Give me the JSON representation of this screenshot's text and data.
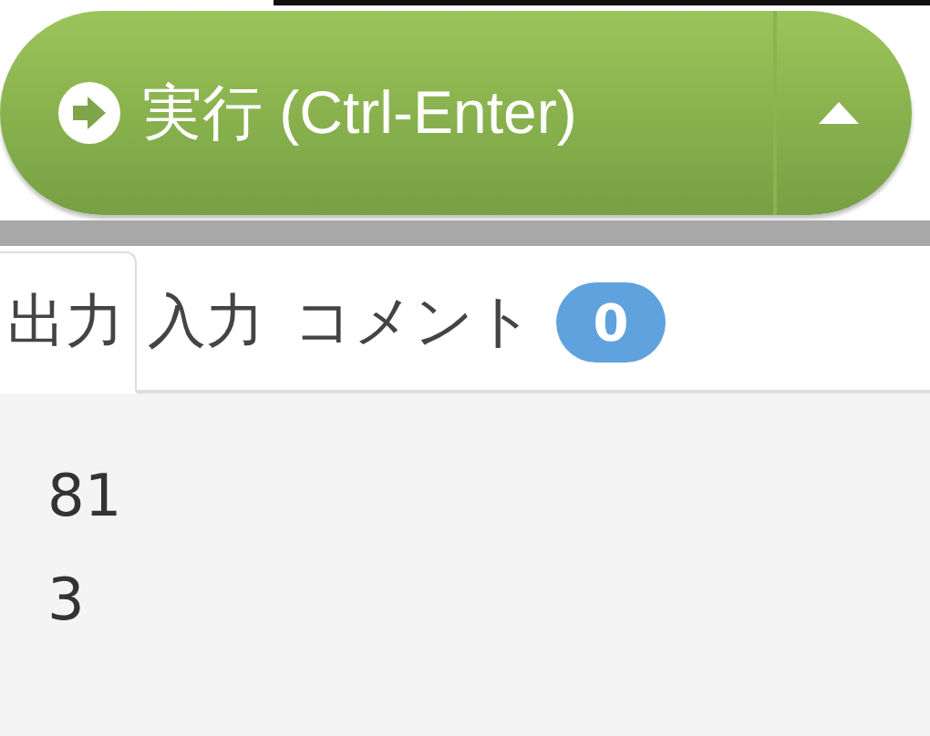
{
  "run_button": {
    "label": "実行 (Ctrl-Enter)"
  },
  "tabs": [
    {
      "label": "出力",
      "selected": true
    },
    {
      "label": "入力",
      "selected": false
    },
    {
      "label": "コメント",
      "selected": false,
      "badge": "0"
    }
  ],
  "output": {
    "lines": [
      "81",
      "3"
    ]
  }
}
